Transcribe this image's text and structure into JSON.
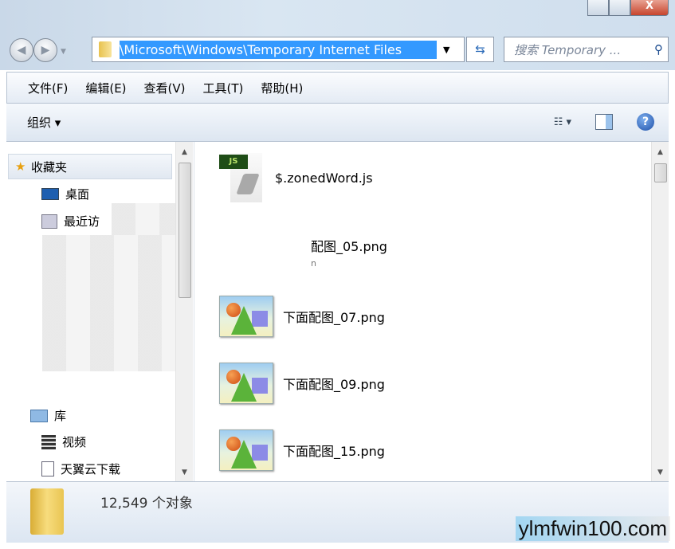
{
  "window": {
    "close_label": "X"
  },
  "address": {
    "path": "\\Microsoft\\Windows\\Temporary Internet Files"
  },
  "search": {
    "placeholder": "搜索 Temporary ..."
  },
  "menu": [
    "文件(F)",
    "编辑(E)",
    "查看(V)",
    "工具(T)",
    "帮助(H)"
  ],
  "toolbar": {
    "organize": "组织 ▾",
    "help": "?"
  },
  "sidebar": {
    "favorites": "收藏夹",
    "desktop": "桌面",
    "recent": "最近访",
    "library": "库",
    "videos": "视频",
    "cloud": "天翼云下载"
  },
  "files": [
    {
      "name": "$.zonedWord.js",
      "type": "js"
    },
    {
      "name": "配图_05.png",
      "type": "none",
      "extra": "n"
    },
    {
      "name": "下面配图_07.png",
      "type": "image"
    },
    {
      "name": "下面配图_09.png",
      "type": "image"
    },
    {
      "name": "下面配图_15.png",
      "type": "image"
    }
  ],
  "status": {
    "count": "12,549 个对象"
  },
  "watermark": "ylmfwin100.com",
  "colors": {
    "selection": "#3399ff",
    "js_tag": "#1f4d17"
  }
}
